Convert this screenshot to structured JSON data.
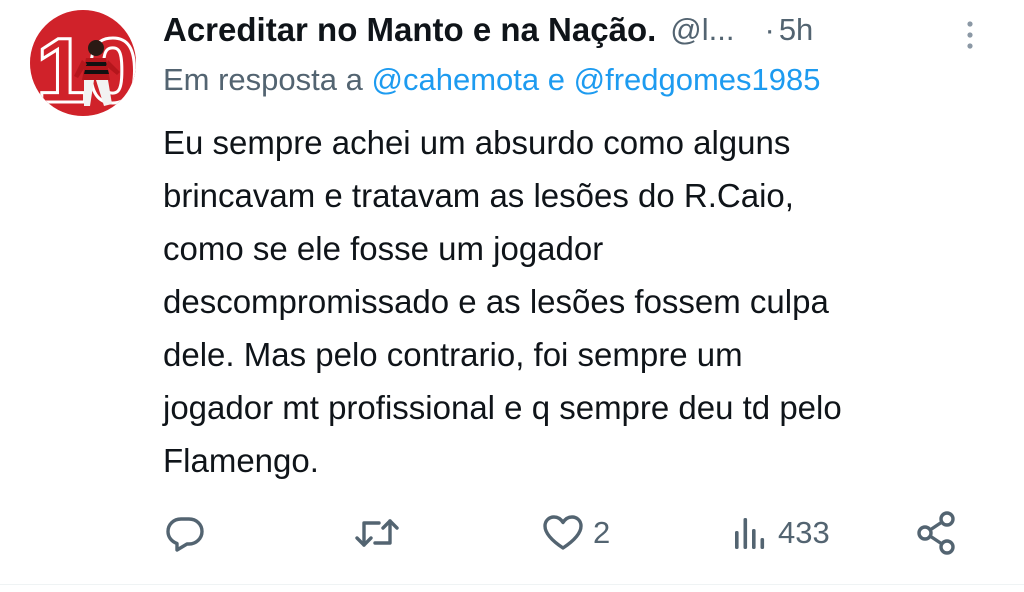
{
  "tweet": {
    "display_name": "Acreditar no Manto e na Nação.",
    "handle": "@l...",
    "separator": "·",
    "time": "5h",
    "reply_prefix": "Em resposta a",
    "reply_mentions": [
      "@cahemota",
      "@fredgomes1985"
    ],
    "reply_joiner": "e",
    "text": "Eu sempre achei um absurdo como alguns\nbrincavam e  tratavam as lesões do R.Caio,\ncomo se ele fosse um jogador\ndescompromissado e as lesões fossem culpa\ndele. Mas pelo contrario, foi sempre um\njogador mt profissional e q sempre deu td pelo\nFlamengo.",
    "avatar_number": "10"
  },
  "actions": {
    "reply_icon": "reply-icon",
    "retweet_icon": "retweet-icon",
    "like_icon": "heart-icon",
    "like_count": "2",
    "views_icon": "views-icon",
    "views_count": "433",
    "share_icon": "share-icon"
  },
  "colors": {
    "text": "#0f1419",
    "secondary": "#536471",
    "accent": "#1d9bf0",
    "avatar_red": "#d62828"
  }
}
